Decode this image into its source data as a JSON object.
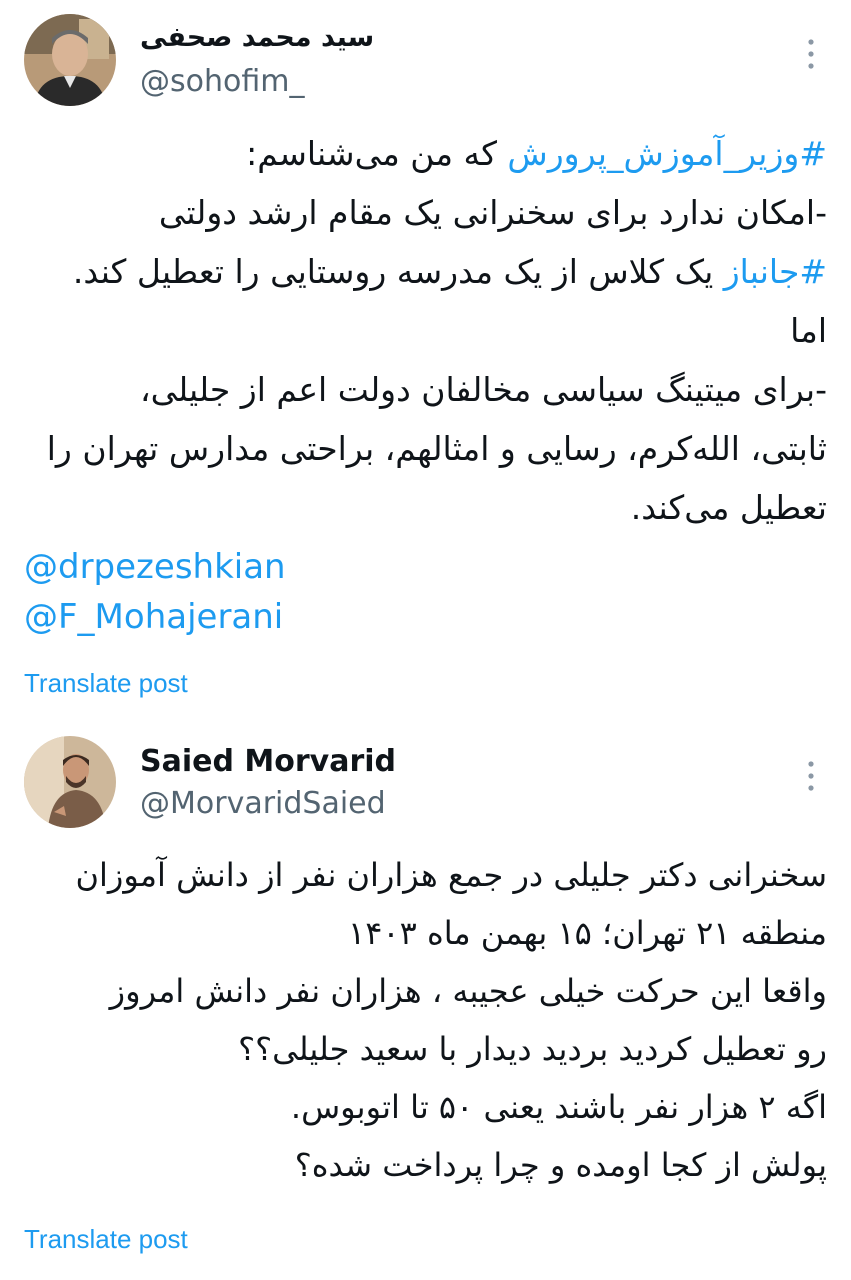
{
  "posts": [
    {
      "display_name": "سید محمد صحفی",
      "handle": "@sohofim_",
      "lines": [
        {
          "parts": [
            {
              "text": "#وزیر_آموزش_پرورش",
              "hashtag": true
            },
            {
              "text": " که من می‌شناسم:",
              "hashtag": false
            }
          ]
        },
        {
          "parts": [
            {
              "text": "-امکان ندارد برای سخنرانی یک مقام ارشد دولتی",
              "hashtag": false
            }
          ]
        },
        {
          "parts": [
            {
              "text": "#جانباز",
              "hashtag": true
            },
            {
              "text": " یک کلاس از یک مدرسه روستایی را تعطیل کند.",
              "hashtag": false
            }
          ]
        },
        {
          "parts": [
            {
              "text": "اما",
              "hashtag": false
            }
          ]
        },
        {
          "parts": [
            {
              "text": "-برای میتینگ سیاسی مخالفان دولت اعم از جلیلی،",
              "hashtag": false
            }
          ]
        },
        {
          "parts": [
            {
              "text": "ثابتی، الله‌کرم، رسایی و امثالهم، براحتی مدارس تهران را",
              "hashtag": false
            }
          ]
        },
        {
          "parts": [
            {
              "text": "تعطیل می‌کند.",
              "hashtag": false
            }
          ]
        }
      ],
      "mentions": [
        "@drpezeshkian",
        "@F_Mohajerani"
      ],
      "translate_label": "Translate post"
    },
    {
      "display_name": "Saied Morvarid",
      "handle": "@MorvaridSaied",
      "lines": [
        {
          "parts": [
            {
              "text": "سخنرانی دکتر جلیلی در جمع هزاران نفر از دانش آموزان",
              "hashtag": false
            }
          ]
        },
        {
          "parts": [
            {
              "text": "منطقه ۲۱ تهران؛ ۱۵ بهمن ماه ۱۴۰۳",
              "hashtag": false
            }
          ]
        },
        {
          "parts": [
            {
              "text": "واقعا این حرکت خیلی عجیبه ، هزاران نفر دانش امروز",
              "hashtag": false
            }
          ]
        },
        {
          "parts": [
            {
              "text": "رو تعطیل کردید بردید دیدار با سعید جلیلی؟؟",
              "hashtag": false
            }
          ]
        },
        {
          "parts": [
            {
              "text": "اگه ۲ هزار نفر باشند یعنی ۵۰ تا اتوبوس.",
              "hashtag": false
            }
          ]
        },
        {
          "parts": [
            {
              "text": "پولش از کجا اومده و چرا پرداخت شده؟",
              "hashtag": false
            }
          ]
        }
      ],
      "mentions": [],
      "translate_label": "Translate post"
    }
  ],
  "colors": {
    "link": "#1d9bf0",
    "text": "#0f1419",
    "secondary": "#536471",
    "divider": "#eff3f4"
  },
  "icons": {
    "more": "more-vertical-icon"
  }
}
